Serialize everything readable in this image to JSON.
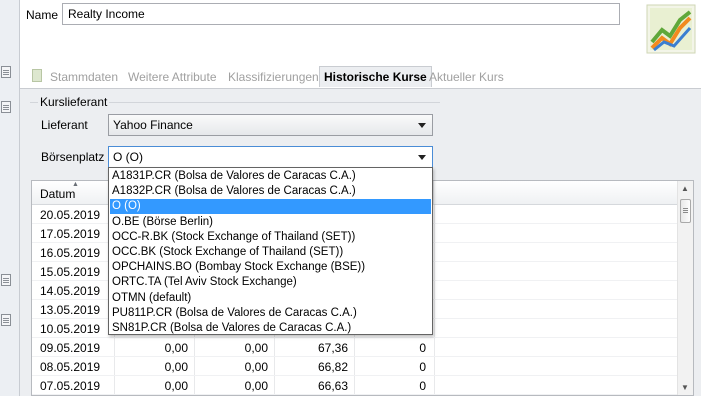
{
  "header": {
    "name_label": "Name",
    "name_value": "Realty Income",
    "logo_icon": "portfolio-performance-logo"
  },
  "tabs": [
    {
      "label": "Stammdaten",
      "active": false
    },
    {
      "label": "Weitere Attribute",
      "active": false
    },
    {
      "label": "Klassifizierungen",
      "active": false
    },
    {
      "label": "Historische Kurse",
      "active": true
    },
    {
      "label": "Aktueller Kurs",
      "active": false
    }
  ],
  "kurslieferant": {
    "group_label": "Kurslieferant",
    "lieferant_label": "Lieferant",
    "lieferant_value": "Yahoo Finance",
    "boersenplatz_label": "Börsenplatz",
    "boersenplatz_value": "O (O)"
  },
  "dropdown": {
    "options": [
      "A1831P.CR (Bolsa de Valores de Caracas C.A.)",
      "A1832P.CR (Bolsa de Valores de Caracas C.A.)",
      "O (O)",
      "O.BE (Börse Berlin)",
      "OCC-R.BK (Stock Exchange of Thailand (SET))",
      "OCC.BK (Stock Exchange of Thailand (SET))",
      "OPCHAINS.BO (Bombay Stock Exchange (BSE))",
      "ORTC.TA (Tel Aviv Stock Exchange)",
      "OTMN (default)",
      "PU811P.CR (Bolsa de Valores de Caracas C.A.)",
      "SN81P.CR (Bolsa de Valores de Caracas C.A.)"
    ],
    "selected_index": 2
  },
  "table": {
    "columns": [
      "Datum"
    ],
    "rows": [
      {
        "date": "20.05.2019",
        "c1": "",
        "c2": "",
        "c3": "",
        "c4": ""
      },
      {
        "date": "17.05.2019",
        "c1": "",
        "c2": "",
        "c3": "",
        "c4": ""
      },
      {
        "date": "16.05.2019",
        "c1": "",
        "c2": "",
        "c3": "",
        "c4": ""
      },
      {
        "date": "15.05.2019",
        "c1": "",
        "c2": "",
        "c3": "",
        "c4": ""
      },
      {
        "date": "14.05.2019",
        "c1": "",
        "c2": "",
        "c3": "",
        "c4": ""
      },
      {
        "date": "13.05.2019",
        "c1": "",
        "c2": "",
        "c3": "",
        "c4": ""
      },
      {
        "date": "10.05.2019",
        "c1": "",
        "c2": "",
        "c3": "",
        "c4": ""
      },
      {
        "date": "09.05.2019",
        "c1": "0,00",
        "c2": "0,00",
        "c3": "67,36",
        "c4": "0"
      },
      {
        "date": "08.05.2019",
        "c1": "0,00",
        "c2": "0,00",
        "c3": "66,82",
        "c4": "0"
      },
      {
        "date": "07.05.2019",
        "c1": "0,00",
        "c2": "0,00",
        "c3": "66,63",
        "c4": "0"
      }
    ]
  }
}
